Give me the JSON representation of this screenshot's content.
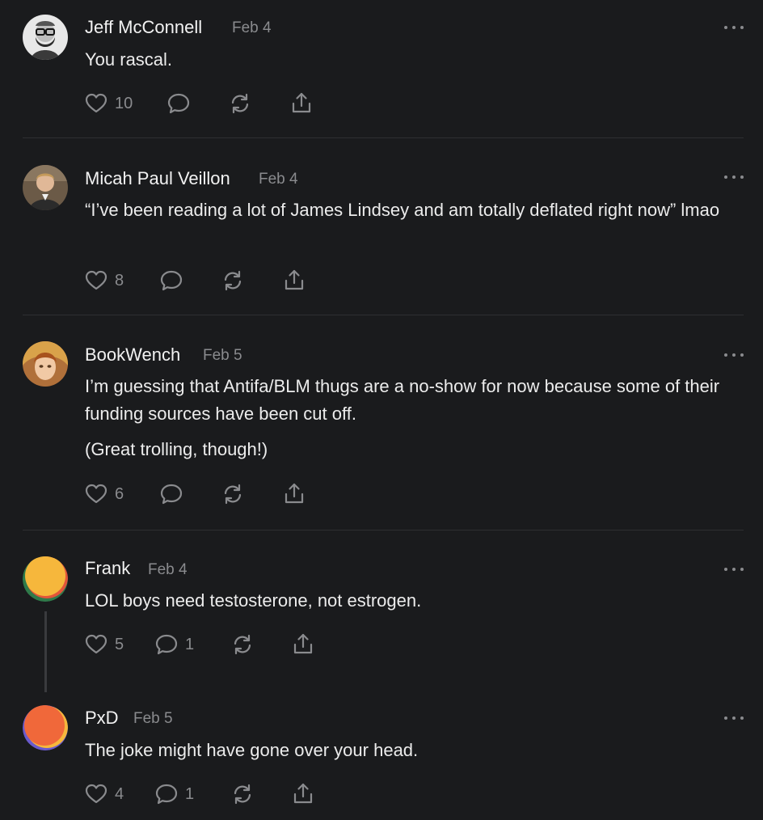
{
  "comments": [
    {
      "name": "Jeff McConnell",
      "date": "Feb 4",
      "body": [
        "You rascal."
      ],
      "likes": "10",
      "replies": "",
      "avatar": "bearded-man-photo"
    },
    {
      "name": "Micah Paul Veillon",
      "date": "Feb 4",
      "body": [
        "“I’ve been reading a lot of James Lindsey and am totally deflated right now” lmao"
      ],
      "likes": "8",
      "replies": "",
      "avatar": "young-man-photo"
    },
    {
      "name": "BookWench",
      "date": "Feb 5",
      "body": [
        "I’m guessing that Antifa/BLM thugs are a no-show for now because some of their funding sources have been cut off.",
        "(Great trolling, though!)"
      ],
      "likes": "6",
      "replies": "",
      "avatar": "illustrated-portrait"
    },
    {
      "name": "Frank",
      "date": "Feb 4",
      "body": [
        "LOL boys need testosterone, not estrogen."
      ],
      "likes": "5",
      "replies": "1",
      "avatar": "gradient-orange-yellow"
    },
    {
      "name": "PxD",
      "date": "Feb 5",
      "body": [
        "The joke might have gone over your head."
      ],
      "likes": "4",
      "replies": "1",
      "avatar": "gradient-red-orange"
    }
  ],
  "icons": {
    "like": "heart-icon",
    "reply": "speech-bubble-icon",
    "restack": "restack-arrows-icon",
    "share": "share-upload-icon",
    "more": "ellipsis-icon"
  },
  "colors": {
    "background": "#1a1b1d",
    "text": "#ececec",
    "muted": "#8a8b8e",
    "divider": "#2e2f32"
  }
}
